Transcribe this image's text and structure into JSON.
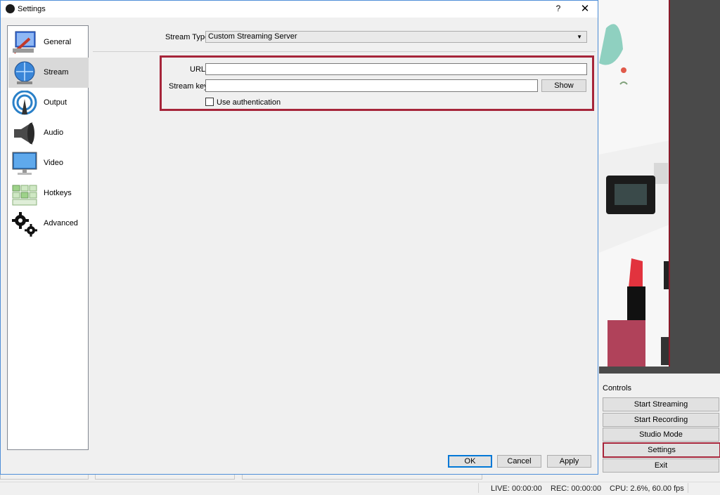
{
  "dialog": {
    "title": "Settings",
    "help_label": "?",
    "close_label": "✕",
    "nav": [
      {
        "label": "General",
        "icon": "general-icon"
      },
      {
        "label": "Stream",
        "icon": "stream-icon"
      },
      {
        "label": "Output",
        "icon": "output-icon"
      },
      {
        "label": "Audio",
        "icon": "audio-icon"
      },
      {
        "label": "Video",
        "icon": "video-icon"
      },
      {
        "label": "Hotkeys",
        "icon": "hotkeys-icon"
      },
      {
        "label": "Advanced",
        "icon": "advanced-icon"
      }
    ],
    "selected_nav": "Stream",
    "stream": {
      "stream_type_label": "Stream Type",
      "stream_type_value": "Custom Streaming Server",
      "url_label": "URL",
      "url_value": "",
      "key_label": "Stream key",
      "key_value": "",
      "show_label": "Show",
      "auth_label": "Use authentication",
      "auth_checked": false
    },
    "buttons": {
      "ok": "OK",
      "cancel": "Cancel",
      "apply": "Apply"
    },
    "highlight_color": "#a6253a"
  },
  "main": {
    "controls_title": "Controls",
    "controls": [
      "Start Streaming",
      "Start Recording",
      "Studio Mode",
      "Settings",
      "Exit"
    ],
    "status": {
      "live": "LIVE: 00:00:00",
      "rec": "REC: 00:00:00",
      "cpu": "CPU: 2.6%, 60.00 fps"
    }
  }
}
